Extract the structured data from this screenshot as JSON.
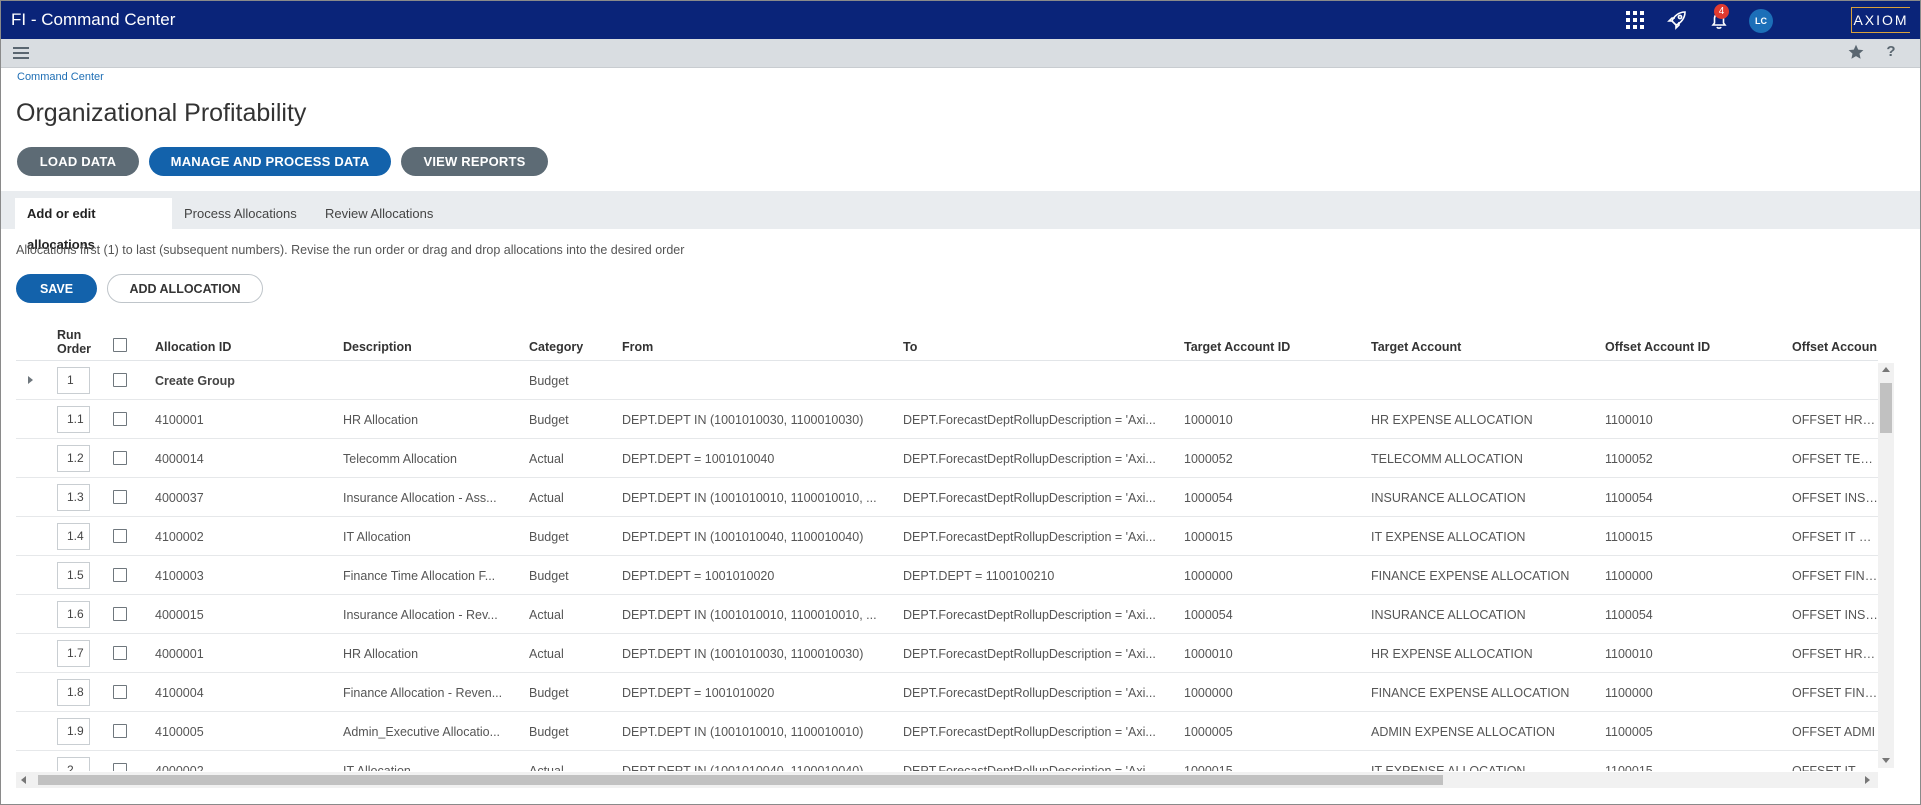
{
  "app": {
    "title": "FI - Command Center",
    "notification_count": "4",
    "avatar_initials": "LC",
    "logo_text": "AXIOM",
    "colors": {
      "topbar": "#0a2479",
      "primary": "#1362ab",
      "secondary": "#5d6b75",
      "badge": "#e03a2f"
    },
    "icons": [
      "apps-grid-icon",
      "rocket-icon",
      "bell-icon",
      "menu-icon",
      "star-icon",
      "help-icon"
    ]
  },
  "breadcrumb": "Command Center",
  "page_title": "Organizational Profitability",
  "actions": {
    "load": "LOAD DATA",
    "manage": "MANAGE AND PROCESS DATA",
    "view": "VIEW REPORTS"
  },
  "tabs": [
    {
      "label": "Add or edit allocations",
      "active": true
    },
    {
      "label": "Process Allocations",
      "active": false
    },
    {
      "label": "Review Allocations",
      "active": false
    }
  ],
  "instructions": "Allocations first (1) to last (subsequent numbers). Revise the run order or drag and drop allocations into the desired order",
  "buttons": {
    "save": "SAVE",
    "add_allocation": "ADD ALLOCATION"
  },
  "table": {
    "headers": {
      "run_order_line1": "Run",
      "run_order_line2": "Order",
      "allocation_id": "Allocation ID",
      "description": "Description",
      "category": "Category",
      "from": "From",
      "to": "To",
      "target_account_id": "Target Account ID",
      "target_account": "Target Account",
      "offset_account_id": "Offset Account ID",
      "offset_account": "Offset Accoun"
    },
    "rows": [
      {
        "order": "1",
        "group": true,
        "allocation_id": "Create Group",
        "description": "",
        "category": "Budget",
        "from": "",
        "to": "",
        "target_account_id": "",
        "target_account": "",
        "offset_account_id": "",
        "offset_account": ""
      },
      {
        "order": "1.1",
        "allocation_id": "4100001",
        "description": "HR Allocation",
        "category": "Budget",
        "from": "DEPT.DEPT IN (1001010030, 1100010030)",
        "to": "DEPT.ForecastDeptRollupDescription = 'Axi...",
        "target_account_id": "1000010",
        "target_account": "HR EXPENSE ALLOCATION",
        "offset_account_id": "1100010",
        "offset_account": "OFFSET HR EX"
      },
      {
        "order": "1.2",
        "allocation_id": "4000014",
        "description": "Telecomm Allocation",
        "category": "Actual",
        "from": "DEPT.DEPT = 1001010040",
        "to": "DEPT.ForecastDeptRollupDescription = 'Axi...",
        "target_account_id": "1000052",
        "target_account": "TELECOMM ALLOCATION",
        "offset_account_id": "1100052",
        "offset_account": "OFFSET TELEC"
      },
      {
        "order": "1.3",
        "allocation_id": "4000037",
        "description": "Insurance Allocation - Ass...",
        "category": "Actual",
        "from": "DEPT.DEPT IN (1001010010, 1100010010, ...",
        "to": "DEPT.ForecastDeptRollupDescription = 'Axi...",
        "target_account_id": "1000054",
        "target_account": "INSURANCE ALLOCATION",
        "offset_account_id": "1100054",
        "offset_account": "OFFSET INSUR"
      },
      {
        "order": "1.4",
        "allocation_id": "4100002",
        "description": "IT Allocation",
        "category": "Budget",
        "from": "DEPT.DEPT IN (1001010040, 1100010040)",
        "to": "DEPT.ForecastDeptRollupDescription = 'Axi...",
        "target_account_id": "1000015",
        "target_account": "IT EXPENSE ALLOCATION",
        "offset_account_id": "1100015",
        "offset_account": "OFFSET IT EXP"
      },
      {
        "order": "1.5",
        "allocation_id": "4100003",
        "description": "Finance Time Allocation F...",
        "category": "Budget",
        "from": "DEPT.DEPT = 1001010020",
        "to": "DEPT.DEPT = 1100100210",
        "target_account_id": "1000000",
        "target_account": "FINANCE EXPENSE ALLOCATION",
        "offset_account_id": "1100000",
        "offset_account": "OFFSET FINAN"
      },
      {
        "order": "1.6",
        "allocation_id": "4000015",
        "description": "Insurance Allocation - Rev...",
        "category": "Actual",
        "from": "DEPT.DEPT IN (1001010010, 1100010010, ...",
        "to": "DEPT.ForecastDeptRollupDescription = 'Axi...",
        "target_account_id": "1000054",
        "target_account": "INSURANCE ALLOCATION",
        "offset_account_id": "1100054",
        "offset_account": "OFFSET INSUR"
      },
      {
        "order": "1.7",
        "allocation_id": "4000001",
        "description": "HR Allocation",
        "category": "Actual",
        "from": "DEPT.DEPT IN (1001010030, 1100010030)",
        "to": "DEPT.ForecastDeptRollupDescription = 'Axi...",
        "target_account_id": "1000010",
        "target_account": "HR EXPENSE ALLOCATION",
        "offset_account_id": "1100010",
        "offset_account": "OFFSET HR EX"
      },
      {
        "order": "1.8",
        "allocation_id": "4100004",
        "description": "Finance Allocation - Reven...",
        "category": "Budget",
        "from": "DEPT.DEPT = 1001010020",
        "to": "DEPT.ForecastDeptRollupDescription = 'Axi...",
        "target_account_id": "1000000",
        "target_account": "FINANCE EXPENSE ALLOCATION",
        "offset_account_id": "1100000",
        "offset_account": "OFFSET FINAN"
      },
      {
        "order": "1.9",
        "allocation_id": "4100005",
        "description": "Admin_Executive Allocatio...",
        "category": "Budget",
        "from": "DEPT.DEPT IN (1001010010, 1100010010)",
        "to": "DEPT.ForecastDeptRollupDescription = 'Axi...",
        "target_account_id": "1000005",
        "target_account": "ADMIN EXPENSE ALLOCATION",
        "offset_account_id": "1100005",
        "offset_account": "OFFSET ADMI"
      },
      {
        "order": "2",
        "allocation_id": "4000002",
        "description": "IT Allocation",
        "category": "Actual",
        "from": "DEPT.DEPT IN (1001010040, 1100010040)",
        "to": "DEPT.ForecastDeptRollupDescription = 'Axi...",
        "target_account_id": "1000015",
        "target_account": "IT EXPENSE ALLOCATION",
        "offset_account_id": "1100015",
        "offset_account": "OFFSET IT EXP"
      }
    ]
  }
}
